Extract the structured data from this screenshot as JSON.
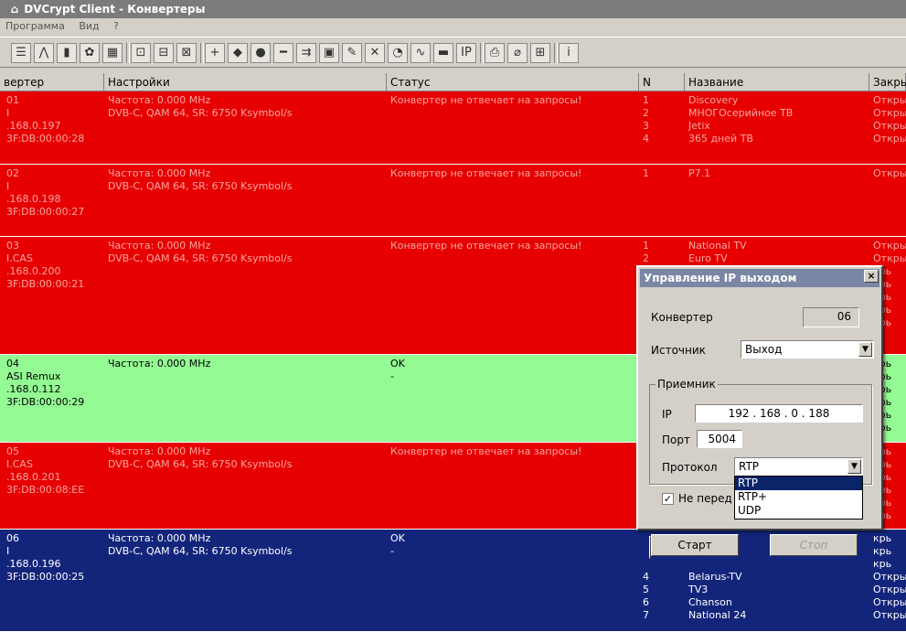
{
  "window": {
    "title": "DVCrypt Client - Конвертеры"
  },
  "menu": [
    "Программа",
    "Вид",
    "?"
  ],
  "toolbar": {
    "buttons": [
      "list-icon",
      "tree-icon",
      "color-icon",
      "users-icon",
      "grid-icon",
      "export-icon",
      "import-icon",
      "send-icon",
      "add-icon",
      "diamond-icon",
      "minus-circle-icon",
      "remove-icon",
      "route-icon",
      "calculator-icon",
      "edit-icon",
      "tools-icon",
      "refresh-icon",
      "wave-icon",
      "monitor-icon",
      "ip-icon",
      "paste-icon",
      "eraser-icon",
      "output-icon",
      "info-icon"
    ],
    "glyphs": [
      "☰",
      "⋀",
      "▮",
      "✿",
      "▦",
      "⊡",
      "⊟",
      "⊠",
      "+",
      "◆",
      "●",
      "━",
      "⇉",
      "▣",
      "✎",
      "✕",
      "◔",
      "∿",
      "▬",
      "IP",
      "⎙",
      "⌀",
      "⊞",
      "i"
    ]
  },
  "columns": [
    "вертер",
    "Настройки",
    "Статус",
    "N",
    "Название",
    "Закры"
  ],
  "rows": [
    {
      "style": "red",
      "conv": [
        "01",
        "I",
        ".168.0.197",
        "3F:DB:00:00:28"
      ],
      "settings": [
        "Частота: 0.000 MHz",
        "DVB-C, QAM 64, SR: 6750 Ksymbol/s"
      ],
      "status": [
        "Конвертер не отвечает на запросы!"
      ],
      "n": [
        "1",
        "2",
        "3",
        "4"
      ],
      "names": [
        "Discovery",
        "МНОГОсерийное ТВ",
        "Jetix",
        "365 дней ТВ"
      ],
      "closed": [
        "Откры",
        "Откры",
        "Откры",
        "Откры"
      ]
    },
    {
      "style": "red",
      "conv": [
        "02",
        "I",
        ".168.0.198",
        "3F:DB:00:00:27"
      ],
      "settings": [
        "Частота: 0.000 MHz",
        "DVB-C, QAM 64, SR: 6750 Ksymbol/s"
      ],
      "status": [
        "Конвертер не отвечает на запросы!"
      ],
      "n": [
        "1"
      ],
      "names": [
        "P7.1"
      ],
      "closed": [
        "Откры"
      ]
    },
    {
      "style": "red",
      "conv": [
        "03",
        "I.CAS",
        ".168.0.200",
        "3F:DB:00:00:21"
      ],
      "settings": [
        "Частота: 0.000 MHz",
        "DVB-C, QAM 64, SR: 6750 Ksymbol/s"
      ],
      "status": [
        "Конвертер не отвечает на запросы!"
      ],
      "n": [
        "1",
        "2"
      ],
      "names": [
        "National TV",
        "Euro TV"
      ],
      "closed": [
        "Откры",
        "Откры",
        "крь",
        "крь",
        "крь",
        "крь",
        "крь"
      ]
    },
    {
      "style": "green",
      "conv": [
        "04",
        "ASI Remux",
        ".168.0.112",
        "3F:DB:00:00:29"
      ],
      "settings": [
        "Частота: 0.000 MHz"
      ],
      "status": [
        "OK",
        "-"
      ],
      "n": [],
      "names": [],
      "closed": [
        "крь",
        "крь",
        "крь",
        "крь",
        "крь",
        "крь"
      ]
    },
    {
      "style": "red",
      "conv": [
        "05",
        "I.CAS",
        ".168.0.201",
        "3F:DB:00:08:EE"
      ],
      "settings": [
        "Частота: 0.000 MHz",
        "DVB-C, QAM 64, SR: 6750 Ksymbol/s"
      ],
      "status": [
        "Конвертер не отвечает на запросы!"
      ],
      "n": [],
      "names": [],
      "closed": [
        "крь",
        "крь",
        "крь",
        "крь",
        "крь",
        "крь"
      ]
    },
    {
      "style": "blue",
      "conv": [
        "06",
        "I",
        ".168.0.196",
        "3F:DB:00:00:25"
      ],
      "settings": [
        "Частота: 0.000 MHz",
        "DVB-C, QAM 64, SR: 6750 Ksymbol/s"
      ],
      "status": [
        "OK",
        "-"
      ],
      "n": [
        "",
        "",
        "",
        "4",
        "5",
        "6",
        "7"
      ],
      "names": [
        "",
        "",
        "",
        "Belarus-TV",
        "TV3",
        "Chanson",
        "National 24"
      ],
      "closed": [
        "крь",
        "крь",
        "крь",
        "Откры",
        "Откры",
        "Откры",
        "Откры"
      ]
    }
  ],
  "dialog": {
    "title": "Управление IP выходом",
    "close": "×",
    "converter_label": "Конвертер",
    "converter_value": "06",
    "source_label": "Источник",
    "source_value": "Выход",
    "receiver_group": "Приемник",
    "ip_label": "IP",
    "ip_value": "192  .  168  .   0   .  188",
    "port_label": "Порт",
    "port_value": "5004",
    "protocol_label": "Протокол",
    "protocol_value": "RTP",
    "protocol_options": [
      "RTP",
      "RTP+",
      "UDP"
    ],
    "checkbox_label": "Не перед",
    "checkbox_checked": "✓",
    "start_label": "Старт",
    "stop_label": "Стоп"
  }
}
